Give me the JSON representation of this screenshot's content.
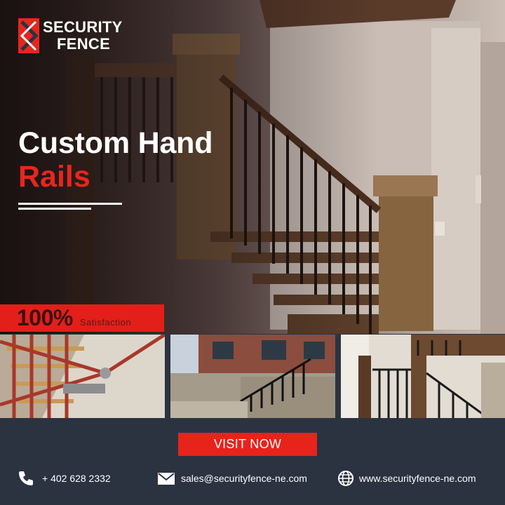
{
  "brand": {
    "name_line1": "SECURITY",
    "name_line2": "FENCE",
    "accent_color": "#e6261f",
    "dark_color": "#2b3341"
  },
  "headline": {
    "line1": "Custom Hand",
    "line2": "Rails"
  },
  "badge": {
    "value": "100%",
    "label": "Satisfaction"
  },
  "thumbnails": [
    {
      "subject": "red steel stair railing"
    },
    {
      "subject": "outdoor stone staircase with black railing"
    },
    {
      "subject": "interior wooden staircase with black balusters"
    }
  ],
  "cta": {
    "label": "VISIT NOW"
  },
  "contacts": {
    "phone": {
      "icon": "phone-icon",
      "text": "+ 402 628 2332"
    },
    "email": {
      "icon": "mail-icon",
      "text": "sales@securityfence-ne.com"
    },
    "website": {
      "icon": "globe-icon",
      "text": "www.securityfence-ne.com"
    }
  }
}
